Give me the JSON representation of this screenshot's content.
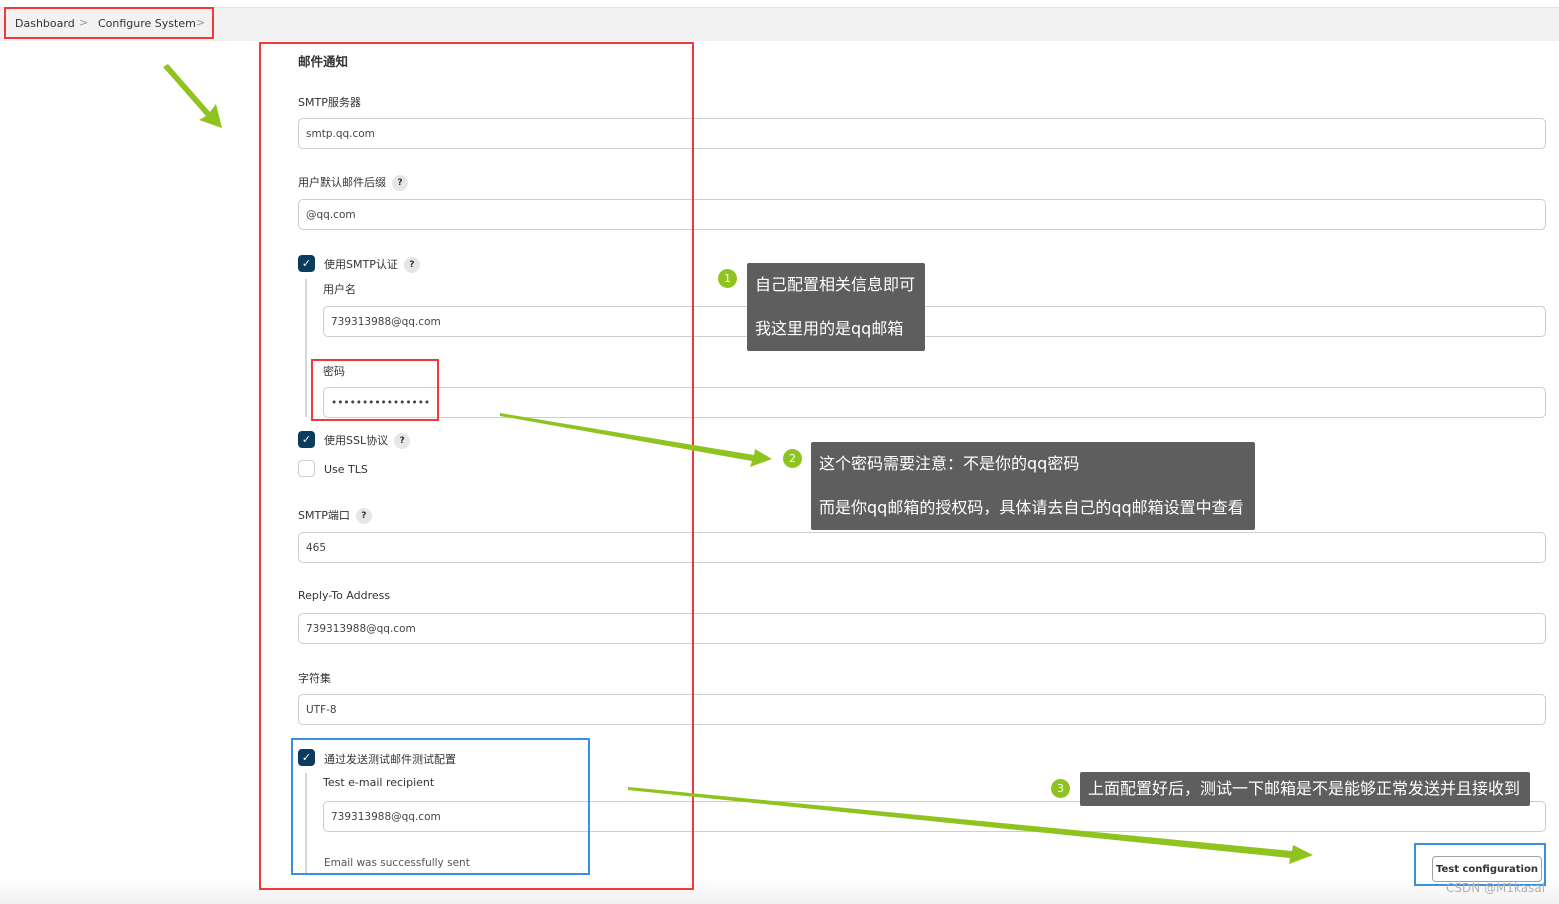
{
  "breadcrumb": {
    "items": [
      "Dashboard",
      "Configure System"
    ],
    "separator": ">"
  },
  "section": {
    "title": "邮件通知"
  },
  "fields": {
    "smtp_server": {
      "label": "SMTP服务器",
      "value": "smtp.qq.com"
    },
    "default_suffix": {
      "label": "用户默认邮件后缀",
      "value": "@qq.com"
    },
    "use_smtp_auth": {
      "label": "使用SMTP认证",
      "checked": true
    },
    "username": {
      "label": "用户名",
      "value": "739313988@qq.com"
    },
    "password": {
      "label": "密码",
      "value": "••••••••••••••••"
    },
    "use_ssl": {
      "label": "使用SSL协议",
      "checked": true
    },
    "use_tls": {
      "label": "Use TLS",
      "checked": false
    },
    "smtp_port": {
      "label": "SMTP端口",
      "value": "465"
    },
    "reply_to": {
      "label": "Reply-To Address",
      "value": "739313988@qq.com"
    },
    "charset": {
      "label": "字符集",
      "value": "UTF-8"
    },
    "test_by_email": {
      "label": "通过发送测试邮件测试配置",
      "checked": true
    },
    "test_recipient": {
      "label": "Test e-mail recipient",
      "value": "739313988@qq.com"
    },
    "status": "Email was successfully sent"
  },
  "help": "?",
  "check": "✓",
  "test_button": "Test configuration",
  "annotations": [
    {
      "num": "1",
      "lines": [
        "自己配置相关信息即可",
        "我这里用的是qq邮箱"
      ]
    },
    {
      "num": "2",
      "lines": [
        "这个密码需要注意：不是你的qq密码",
        "而是你qq邮箱的授权码，具体请去自己的qq邮箱设置中查看"
      ]
    },
    {
      "num": "3",
      "lines": [
        "上面配置好后，测试一下邮箱是不是能够正常发送并且接收到"
      ]
    }
  ],
  "watermark": "CSDN @M1kasal",
  "colors": {
    "annotation_arrow": "#8fc31f",
    "highlight_red": "#f03a3a",
    "highlight_blue": "#3a8fe0",
    "checkbox": "#0b3b5e"
  }
}
